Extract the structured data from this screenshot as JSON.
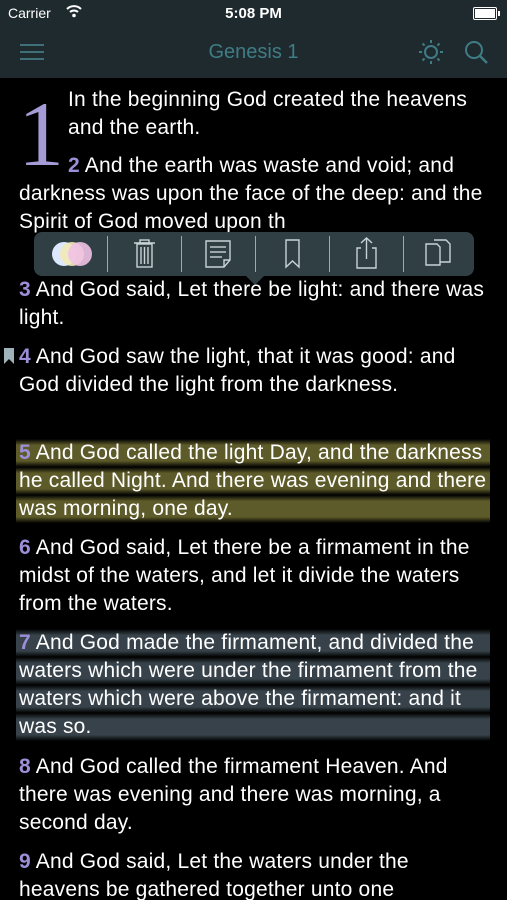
{
  "status_bar": {
    "carrier": "Carrier",
    "time": "5:08 PM"
  },
  "nav": {
    "title": "Genesis 1",
    "icons": [
      "menu-icon",
      "brightness-icon",
      "search-icon"
    ]
  },
  "chapter_number": "1",
  "verses": [
    {
      "n": "",
      "text": "In the beginning God created the heavens and the earth."
    },
    {
      "n": "2",
      "text": " And the earth was waste and void; and darkness was upon the face of the deep: and the Spirit of God moved upon th"
    },
    {
      "n": "3",
      "text": " And God said, Let there be light: and there was light."
    },
    {
      "n": "4",
      "text": " And God saw the light, that it was good: and God divided the light from the darkness."
    },
    {
      "n": "5",
      "text": " And God called the light Day, and the darkness he called Night. And there was evening and there was morning, one day."
    },
    {
      "n": "6",
      "text": " And God said, Let there be a firmament in the midst of the waters, and let it divide the waters from the waters."
    },
    {
      "n": "7",
      "text": " And God made the firmament, and divided the waters which were under the firmament from the waters which were above the firmament: and it was so."
    },
    {
      "n": "8",
      "text": " And God called the firmament Heaven. And there was evening and there was morning, a second day."
    },
    {
      "n": "9",
      "text": " And God said, Let the waters under the heavens be gathered together unto one"
    }
  ],
  "toolbar": {
    "buttons": [
      "highlight-color-icon",
      "trash-icon",
      "note-icon",
      "bookmark-icon",
      "share-icon",
      "copy-icon"
    ]
  },
  "colors": {
    "accent": "#9d8ed8",
    "nav_bg": "#1f2a2e",
    "nav_title": "#3f7c86",
    "highlight_yellow": "#68652e",
    "highlight_blue": "#3a464e"
  }
}
